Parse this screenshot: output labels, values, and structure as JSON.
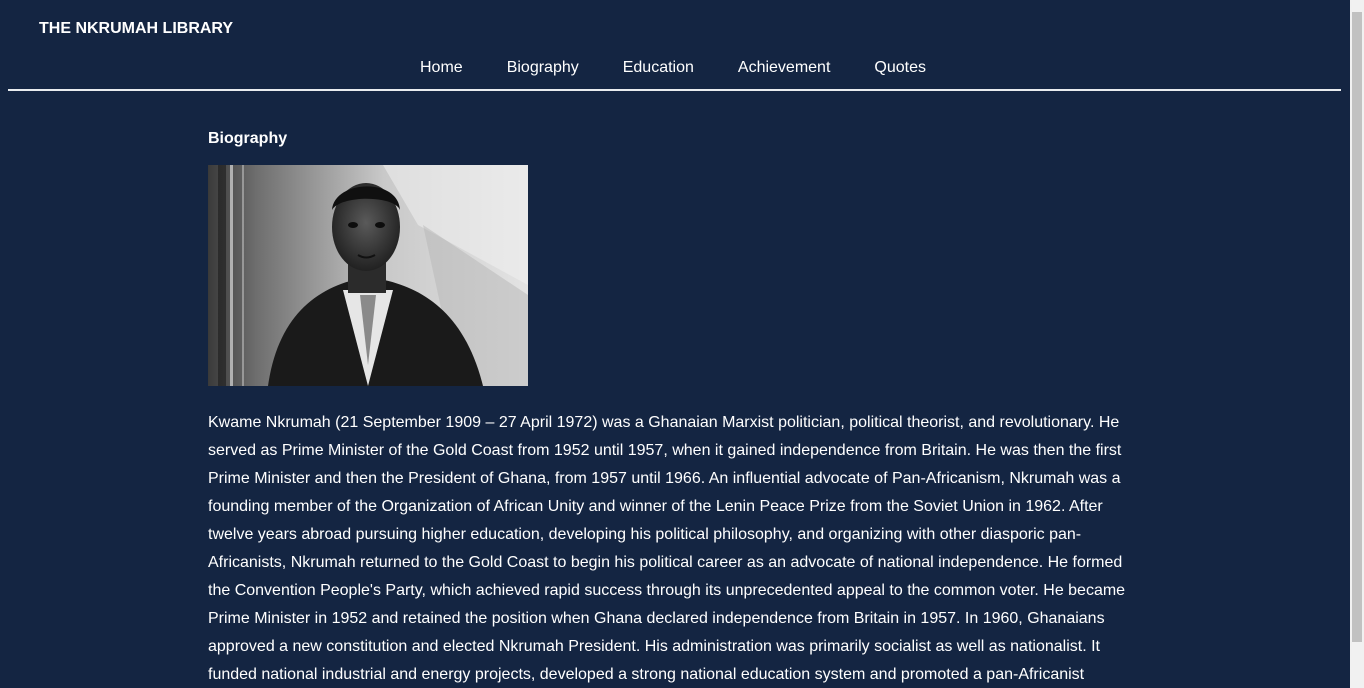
{
  "brand": {
    "name": "THE NKRUMAH LIBRARY"
  },
  "nav": {
    "items": [
      {
        "label": "Home"
      },
      {
        "label": "Biography"
      },
      {
        "label": "Education"
      },
      {
        "label": "Achievement"
      },
      {
        "label": "Quotes"
      }
    ]
  },
  "main": {
    "title": "Biography",
    "paragraph": "Kwame Nkrumah (21 September 1909 – 27 April 1972) was a Ghanaian Marxist politician, political theorist, and revolutionary. He served as Prime Minister of the Gold Coast from 1952 until 1957, when it gained independence from Britain. He was then the first Prime Minister and then the President of Ghana, from 1957 until 1966. An influential advocate of Pan-Africanism, Nkrumah was a founding member of the Organization of African Unity and winner of the Lenin Peace Prize from the Soviet Union in 1962. After twelve years abroad pursuing higher education, developing his political philosophy, and organizing with other diasporic pan-Africanists, Nkrumah returned to the Gold Coast to begin his political career as an advocate of national independence. He formed the Convention People's Party, which achieved rapid success through its unprecedented appeal to the common voter. He became Prime Minister in 1952 and retained the position when Ghana declared independence from Britain in 1957. In 1960, Ghanaians approved a new constitution and elected Nkrumah President. His administration was primarily socialist as well as nationalist. It funded national industrial and energy projects, developed a strong national education system and promoted a pan-Africanist"
  },
  "colors": {
    "background": "#142542",
    "text": "#ffffff",
    "divider": "#e9ecef"
  }
}
